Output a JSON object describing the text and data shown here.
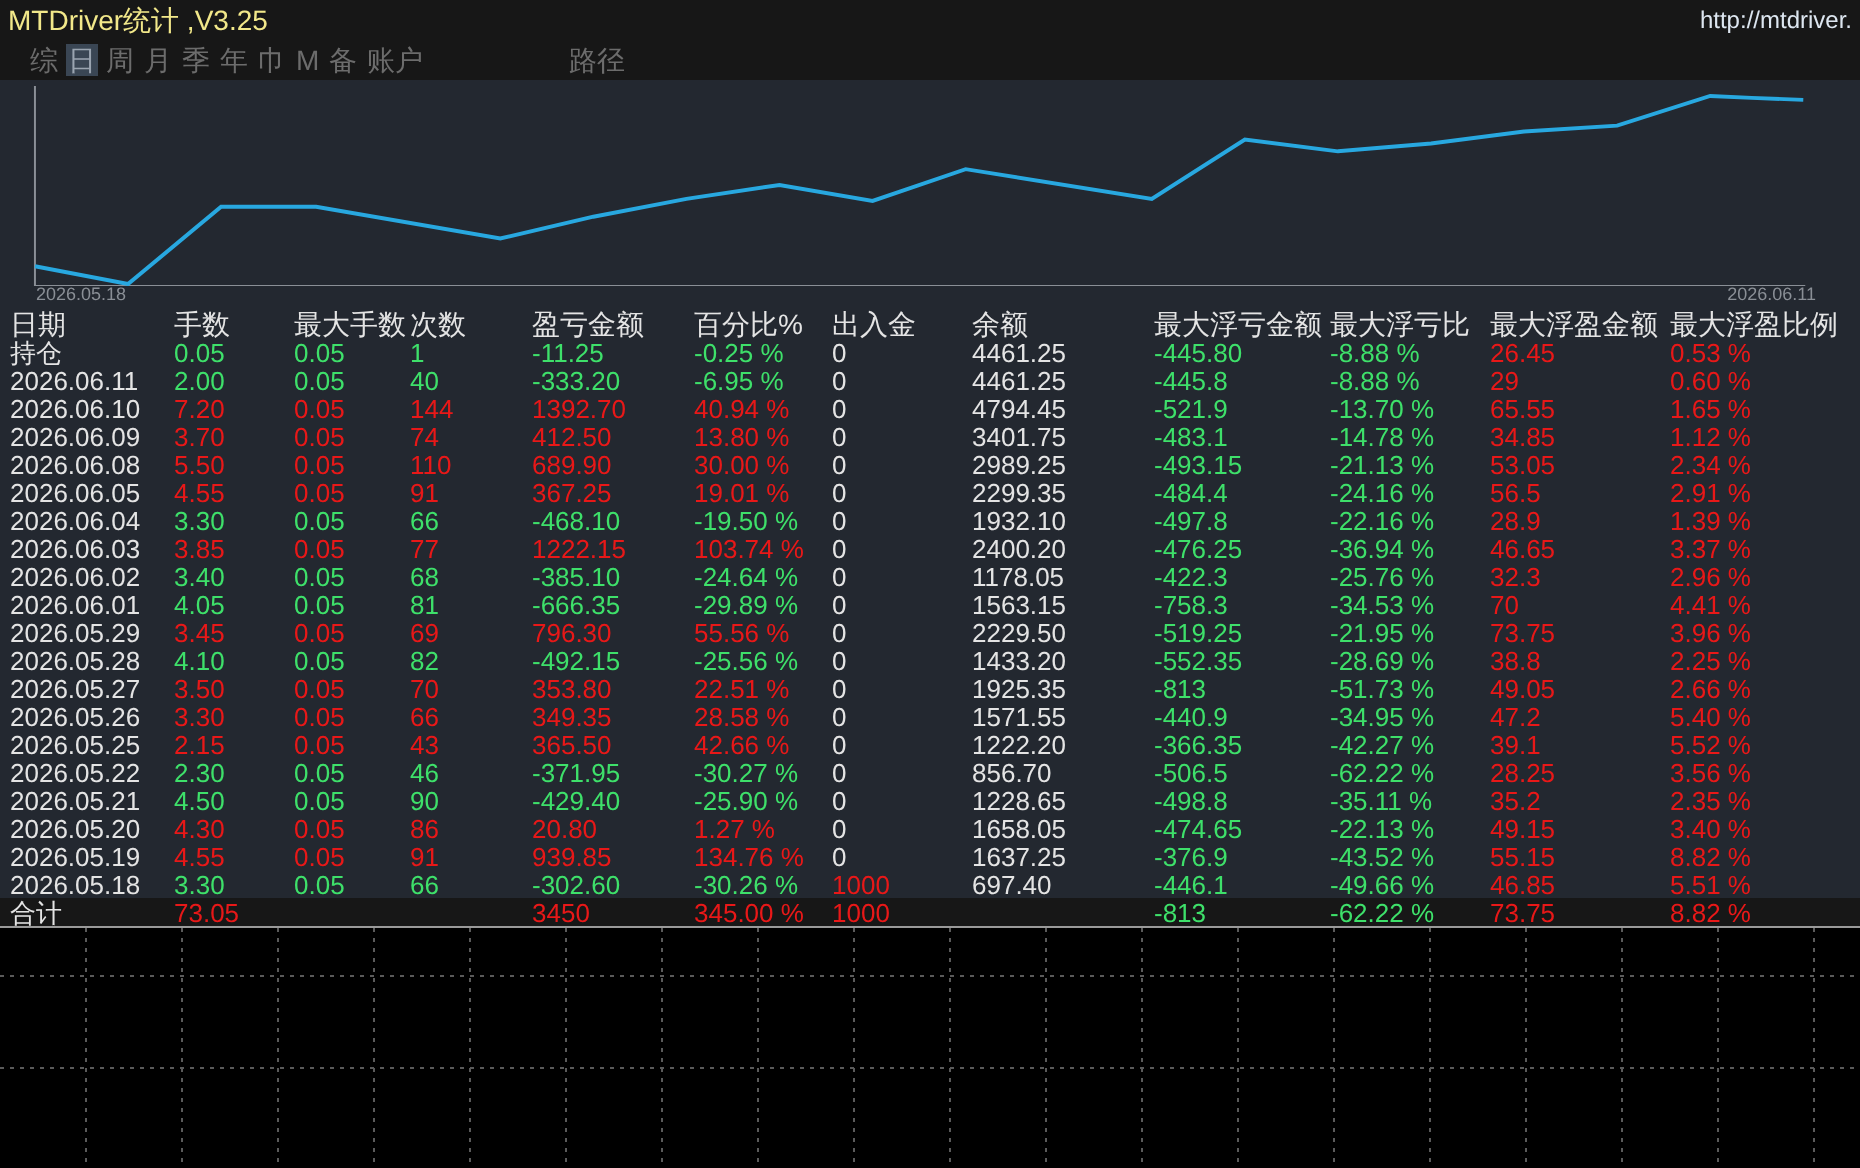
{
  "window": {
    "title": "MTDriver统计 ,V3.25",
    "url": "http://mtdriver."
  },
  "tabs": [
    {
      "label": "综",
      "selected": false
    },
    {
      "label": "日",
      "selected": true
    },
    {
      "label": "周",
      "selected": false
    },
    {
      "label": "月",
      "selected": false
    },
    {
      "label": "季",
      "selected": false
    },
    {
      "label": "年",
      "selected": false
    },
    {
      "label": "巾",
      "selected": false
    },
    {
      "label": "M",
      "selected": false
    },
    {
      "label": "备",
      "selected": false
    },
    {
      "label": "账户",
      "selected": false
    }
  ],
  "path_tab": {
    "label": "路径",
    "selected": false
  },
  "chart": {
    "start_label": "2026.05.18",
    "end_label": "2026.06.11"
  },
  "table": {
    "columns": [
      "日期",
      "手数",
      "最大手数",
      "次数",
      "盈亏金额",
      "百分比%",
      "出入金",
      "余额",
      "最大浮亏金额",
      "最大浮亏比",
      "最大浮盈金额",
      "最大浮盈比例"
    ],
    "rows": [
      {
        "kind": "loss",
        "deposit": false,
        "cells": [
          "持仓",
          "0.05",
          "0.05",
          "1",
          "-11.25",
          "-0.25 %",
          "0",
          "4461.25",
          "-445.80",
          "-8.88 %",
          "26.45",
          "0.53 %"
        ]
      },
      {
        "kind": "loss",
        "deposit": false,
        "cells": [
          "2026.06.11",
          "2.00",
          "0.05",
          "40",
          "-333.20",
          "-6.95 %",
          "0",
          "4461.25",
          "-445.8",
          "-8.88 %",
          "29",
          "0.60 %"
        ]
      },
      {
        "kind": "win",
        "deposit": false,
        "cells": [
          "2026.06.10",
          "7.20",
          "0.05",
          "144",
          "1392.70",
          "40.94 %",
          "0",
          "4794.45",
          "-521.9",
          "-13.70 %",
          "65.55",
          "1.65 %"
        ]
      },
      {
        "kind": "win",
        "deposit": false,
        "cells": [
          "2026.06.09",
          "3.70",
          "0.05",
          "74",
          "412.50",
          "13.80 %",
          "0",
          "3401.75",
          "-483.1",
          "-14.78 %",
          "34.85",
          "1.12 %"
        ]
      },
      {
        "kind": "win",
        "deposit": false,
        "cells": [
          "2026.06.08",
          "5.50",
          "0.05",
          "110",
          "689.90",
          "30.00 %",
          "0",
          "2989.25",
          "-493.15",
          "-21.13 %",
          "53.05",
          "2.34 %"
        ]
      },
      {
        "kind": "win",
        "deposit": false,
        "cells": [
          "2026.06.05",
          "4.55",
          "0.05",
          "91",
          "367.25",
          "19.01 %",
          "0",
          "2299.35",
          "-484.4",
          "-24.16 %",
          "56.5",
          "2.91 %"
        ]
      },
      {
        "kind": "loss",
        "deposit": false,
        "cells": [
          "2026.06.04",
          "3.30",
          "0.05",
          "66",
          "-468.10",
          "-19.50 %",
          "0",
          "1932.10",
          "-497.8",
          "-22.16 %",
          "28.9",
          "1.39 %"
        ]
      },
      {
        "kind": "win",
        "deposit": false,
        "cells": [
          "2026.06.03",
          "3.85",
          "0.05",
          "77",
          "1222.15",
          "103.74 %",
          "0",
          "2400.20",
          "-476.25",
          "-36.94 %",
          "46.65",
          "3.37 %"
        ]
      },
      {
        "kind": "loss",
        "deposit": false,
        "cells": [
          "2026.06.02",
          "3.40",
          "0.05",
          "68",
          "-385.10",
          "-24.64 %",
          "0",
          "1178.05",
          "-422.3",
          "-25.76 %",
          "32.3",
          "2.96 %"
        ]
      },
      {
        "kind": "loss",
        "deposit": false,
        "cells": [
          "2026.06.01",
          "4.05",
          "0.05",
          "81",
          "-666.35",
          "-29.89 %",
          "0",
          "1563.15",
          "-758.3",
          "-34.53 %",
          "70",
          "4.41 %"
        ]
      },
      {
        "kind": "win",
        "deposit": false,
        "cells": [
          "2026.05.29",
          "3.45",
          "0.05",
          "69",
          "796.30",
          "55.56 %",
          "0",
          "2229.50",
          "-519.25",
          "-21.95 %",
          "73.75",
          "3.96 %"
        ]
      },
      {
        "kind": "loss",
        "deposit": false,
        "cells": [
          "2026.05.28",
          "4.10",
          "0.05",
          "82",
          "-492.15",
          "-25.56 %",
          "0",
          "1433.20",
          "-552.35",
          "-28.69 %",
          "38.8",
          "2.25 %"
        ]
      },
      {
        "kind": "win",
        "deposit": false,
        "cells": [
          "2026.05.27",
          "3.50",
          "0.05",
          "70",
          "353.80",
          "22.51 %",
          "0",
          "1925.35",
          "-813",
          "-51.73 %",
          "49.05",
          "2.66 %"
        ]
      },
      {
        "kind": "win",
        "deposit": false,
        "cells": [
          "2026.05.26",
          "3.30",
          "0.05",
          "66",
          "349.35",
          "28.58 %",
          "0",
          "1571.55",
          "-440.9",
          "-34.95 %",
          "47.2",
          "5.40 %"
        ]
      },
      {
        "kind": "win",
        "deposit": false,
        "cells": [
          "2026.05.25",
          "2.15",
          "0.05",
          "43",
          "365.50",
          "42.66 %",
          "0",
          "1222.20",
          "-366.35",
          "-42.27 %",
          "39.1",
          "5.52 %"
        ]
      },
      {
        "kind": "loss",
        "deposit": false,
        "cells": [
          "2026.05.22",
          "2.30",
          "0.05",
          "46",
          "-371.95",
          "-30.27 %",
          "0",
          "856.70",
          "-506.5",
          "-62.22 %",
          "28.25",
          "3.56 %"
        ]
      },
      {
        "kind": "loss",
        "deposit": false,
        "cells": [
          "2026.05.21",
          "4.50",
          "0.05",
          "90",
          "-429.40",
          "-25.90 %",
          "0",
          "1228.65",
          "-498.8",
          "-35.11 %",
          "35.2",
          "2.35 %"
        ]
      },
      {
        "kind": "win",
        "deposit": false,
        "cells": [
          "2026.05.20",
          "4.30",
          "0.05",
          "86",
          "20.80",
          "1.27 %",
          "0",
          "1658.05",
          "-474.65",
          "-22.13 %",
          "49.15",
          "3.40 %"
        ]
      },
      {
        "kind": "win",
        "deposit": false,
        "cells": [
          "2026.05.19",
          "4.55",
          "0.05",
          "91",
          "939.85",
          "134.76 %",
          "0",
          "1637.25",
          "-376.9",
          "-43.52 %",
          "55.15",
          "8.82 %"
        ]
      },
      {
        "kind": "loss",
        "deposit": true,
        "cells": [
          "2026.05.18",
          "3.30",
          "0.05",
          "66",
          "-302.60",
          "-30.26 %",
          "1000",
          "697.40",
          "-446.1",
          "-49.66 %",
          "46.85",
          "5.51 %"
        ]
      }
    ],
    "total": {
      "label": "合计",
      "lots": "73.05",
      "pnl": "3450",
      "percent": "345.00 %",
      "funds": "1000",
      "max_float_loss": "-813",
      "max_float_loss_pct": "-62.22 %",
      "max_float_profit": "73.75",
      "max_float_profit_pct": "8.82 %"
    }
  }
}
